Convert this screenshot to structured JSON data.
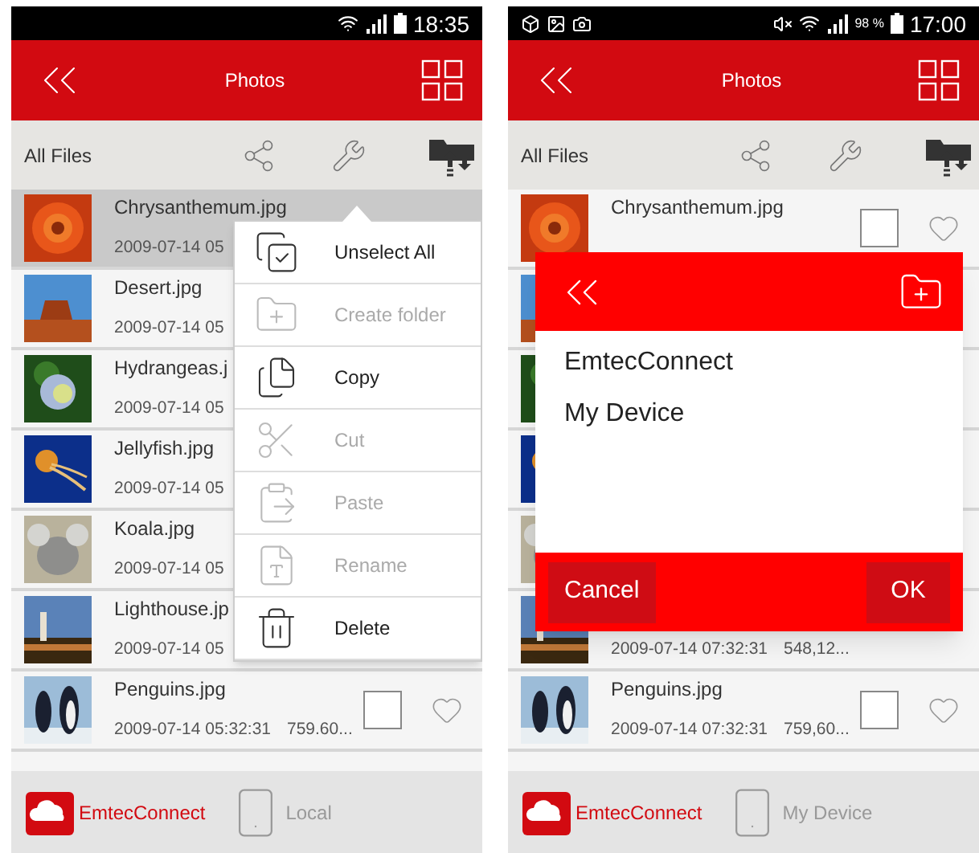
{
  "phones": [
    {
      "status_bar": {
        "kind": "basic",
        "time": "18:35"
      },
      "header": {
        "title": "Photos"
      },
      "toolbar": {
        "label": "All Files"
      },
      "rows": [
        {
          "name": "Chrysanthemum.jpg",
          "date": "2009-07-14 05",
          "selected": true
        },
        {
          "name": "Desert.jpg",
          "date": "2009-07-14 05",
          "selected": false
        },
        {
          "name": "Hydrangeas.j",
          "date": "2009-07-14 05",
          "selected": false
        },
        {
          "name": "Jellyfish.jpg",
          "date": "2009-07-14 05",
          "selected": false
        },
        {
          "name": "Koala.jpg",
          "date": "2009-07-14 05",
          "selected": false
        },
        {
          "name": "Lighthouse.jp",
          "date": "2009-07-14 05",
          "selected": false
        },
        {
          "name": "Penguins.jpg",
          "date": "2009-07-14 05:32:31",
          "size": "759.60...",
          "checked": false,
          "selected": false
        }
      ],
      "overlay": {
        "kind": "menu",
        "items": [
          {
            "label": "Unselect All",
            "disabled": false
          },
          {
            "label": "Create folder",
            "disabled": true
          },
          {
            "label": "Copy",
            "disabled": false
          },
          {
            "label": "Cut",
            "disabled": true
          },
          {
            "label": "Paste",
            "disabled": true
          },
          {
            "label": "Rename",
            "disabled": true
          },
          {
            "label": "Delete",
            "disabled": false
          }
        ]
      },
      "tabs": [
        {
          "label": "EmtecConnect",
          "selected": true
        },
        {
          "label": "Local",
          "selected": false
        }
      ]
    },
    {
      "status_bar": {
        "kind": "full",
        "battery": "98 %",
        "time": "17:00"
      },
      "header": {
        "title": "Photos"
      },
      "toolbar": {
        "label": "All Files"
      },
      "rows": [
        {
          "name": "Chrysanthemum.jpg",
          "checked": false,
          "selected": false
        },
        {
          "selected": false
        },
        {
          "selected": false
        },
        {
          "selected": false
        },
        {
          "selected": false
        },
        {
          "date": "2009-07-14 07:32:31",
          "size": "548,12...",
          "selected": false
        },
        {
          "name": "Penguins.jpg",
          "date": "2009-07-14 07:32:31",
          "size": "759,60...",
          "checked": false,
          "selected": false
        }
      ],
      "overlay": {
        "kind": "dialog",
        "items": [
          "EmtecConnect",
          "My Device"
        ],
        "buttons": [
          "Cancel",
          "OK"
        ]
      },
      "tabs": [
        {
          "label": "EmtecConnect",
          "selected": true
        },
        {
          "label": "My Device",
          "selected": false
        }
      ]
    }
  ]
}
